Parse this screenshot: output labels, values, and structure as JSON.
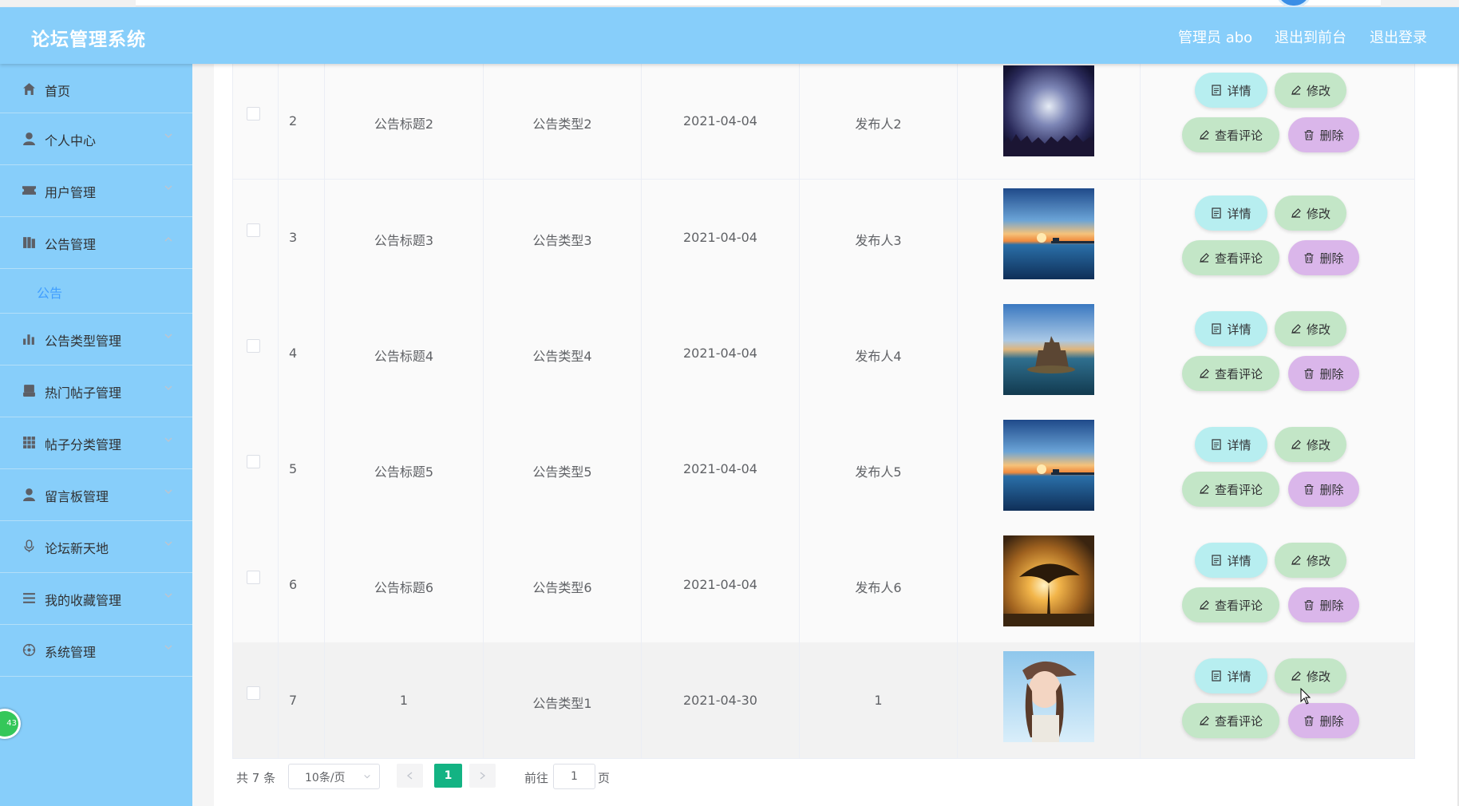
{
  "header": {
    "logo": "论坛管理系统",
    "admin": "管理员 abo",
    "to_front": "退出到前台",
    "logout": "退出登录"
  },
  "sidebar": {
    "items": [
      {
        "label": "首页",
        "icon": "home-icon"
      },
      {
        "label": "个人中心",
        "icon": "user-icon"
      },
      {
        "label": "用户管理",
        "icon": "ticket-icon"
      },
      {
        "label": "公告管理",
        "icon": "book-icon"
      },
      {
        "label": "公告类型管理",
        "icon": "bar-chart-icon"
      },
      {
        "label": "热门帖子管理",
        "icon": "printer-icon"
      },
      {
        "label": "帖子分类管理",
        "icon": "grid-icon"
      },
      {
        "label": "留言板管理",
        "icon": "person-icon"
      },
      {
        "label": "论坛新天地",
        "icon": "microphone-icon"
      },
      {
        "label": "我的收藏管理",
        "icon": "list-icon"
      },
      {
        "label": "系统管理",
        "icon": "settings-icon"
      }
    ],
    "submenu": {
      "label": "公告"
    },
    "badge": "43"
  },
  "buttons": {
    "detail": "详情",
    "edit": "修改",
    "comments": "查看评论",
    "delete": "删除"
  },
  "rows": [
    {
      "idx": "2",
      "title": "公告标题2",
      "type": "公告类型2",
      "date": "2021-04-04",
      "publisher": "发布人2",
      "image": "night-concert"
    },
    {
      "idx": "3",
      "title": "公告标题3",
      "type": "公告类型3",
      "date": "2021-04-04",
      "publisher": "发布人3",
      "image": "sunset-pier"
    },
    {
      "idx": "4",
      "title": "公告标题4",
      "type": "公告类型4",
      "date": "2021-04-04",
      "publisher": "发布人4",
      "image": "island-castle"
    },
    {
      "idx": "5",
      "title": "公告标题5",
      "type": "公告类型5",
      "date": "2021-04-04",
      "publisher": "发布人5",
      "image": "sunset-pier"
    },
    {
      "idx": "6",
      "title": "公告标题6",
      "type": "公告类型6",
      "date": "2021-04-04",
      "publisher": "发布人6",
      "image": "tree-sunset"
    },
    {
      "idx": "7",
      "title": "1",
      "type": "公告类型1",
      "date": "2021-04-30",
      "publisher": "1",
      "image": "girl-cap"
    }
  ],
  "pagination": {
    "total": "共 7 条",
    "page_size": "10条/页",
    "current": "1",
    "goto_label": "前往",
    "goto_value": "1",
    "page_label": "页"
  },
  "colors": {
    "header": "#87cefa",
    "active_page": "#13b383",
    "detail_button": "#b7eef0",
    "edit_button": "#c3e6c7",
    "delete_button": "#dab6ea"
  }
}
